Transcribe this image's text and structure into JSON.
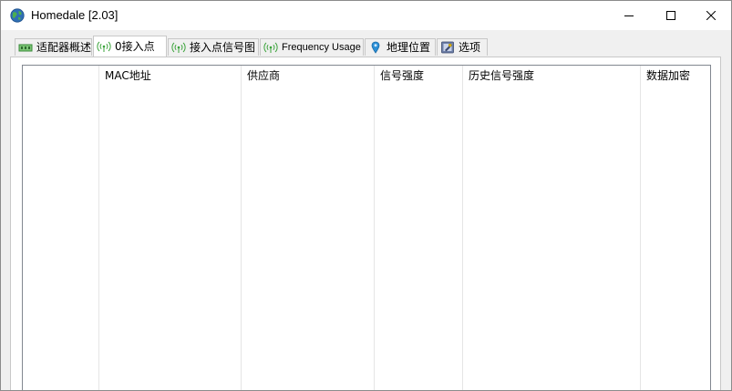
{
  "window": {
    "title": "Homedale [2.03]",
    "controls": {
      "minimize": "minimize-icon",
      "maximize": "maximize-icon",
      "close": "close-icon"
    }
  },
  "tabs": [
    {
      "label": "适配器概述",
      "icon": "network-adapter-icon",
      "active": false
    },
    {
      "label": "0接入点",
      "icon": "wifi-signal-icon",
      "active": true
    },
    {
      "label": "接入点信号图",
      "icon": "wifi-signal-icon",
      "active": false
    },
    {
      "label": "Frequency Usage",
      "icon": "wifi-signal-icon",
      "active": false
    },
    {
      "label": "地理位置",
      "icon": "location-pin-icon",
      "active": false
    },
    {
      "label": "选项",
      "icon": "settings-icon",
      "active": false
    }
  ],
  "table": {
    "columns": [
      "",
      "MAC地址",
      "供应商",
      "信号强度",
      "历史信号强度",
      "数据加密"
    ],
    "rows": []
  },
  "colors": {
    "accent_green": "#3aa33a",
    "globe_blue": "#2f6fb5",
    "pin_blue": "#2a8fd6"
  }
}
